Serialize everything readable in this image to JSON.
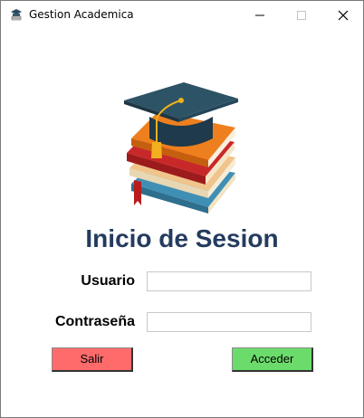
{
  "window": {
    "title": "Gestion Academica",
    "icon": "graduation-cap-icon"
  },
  "login": {
    "heading": "Inicio de Sesion",
    "user_label": "Usuario",
    "user_value": "",
    "password_label": "Contraseña",
    "password_value": ""
  },
  "buttons": {
    "exit_label": "Salir",
    "exit_color": "#ff6b6b",
    "login_label": "Acceder",
    "login_color": "#6bdc6b"
  },
  "colors": {
    "heading": "#243b5e"
  }
}
